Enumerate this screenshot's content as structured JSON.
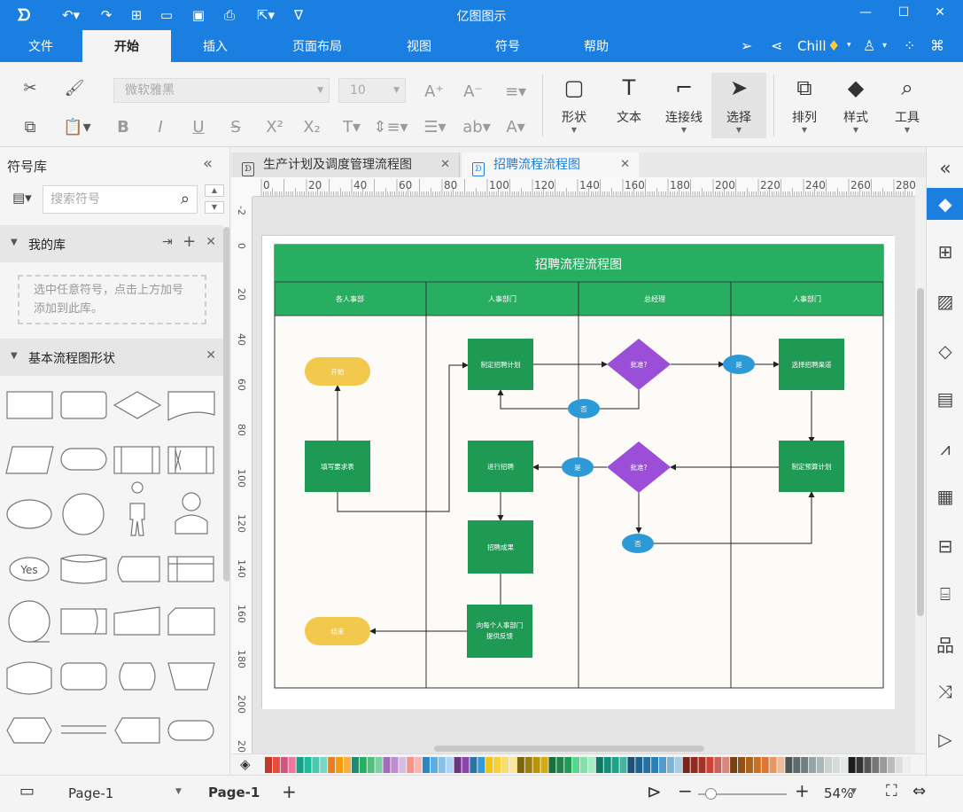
{
  "app": {
    "title": "亿图图示"
  },
  "menu": {
    "tabs": [
      "文件",
      "开始",
      "插入",
      "页面布局",
      "视图",
      "符号",
      "帮助"
    ],
    "active": "开始",
    "user": "Chill"
  },
  "ribbon": {
    "font_name": "微软雅黑",
    "font_size": "10",
    "big_buttons": [
      "形状",
      "文本",
      "连接线",
      "选择",
      "排列",
      "样式",
      "工具"
    ]
  },
  "left_panel": {
    "title": "符号库",
    "search_placeholder": "搜索符号",
    "my_library": "我的库",
    "my_library_hint": "选中任意符号，点击上方加号添加到此库。",
    "basic_shapes": "基本流程图形状",
    "yes_shape_label": "Yes"
  },
  "doc_tabs": [
    {
      "label": "生产计划及调度管理流程图",
      "active": false
    },
    {
      "label": "招聘流程流程图",
      "active": true
    }
  ],
  "rulers": {
    "top": [
      "0",
      "20",
      "40",
      "60",
      "80",
      "100",
      "120",
      "140",
      "160",
      "180",
      "200",
      "220",
      "240",
      "260",
      "280"
    ],
    "left": [
      "-2",
      "0",
      "20",
      "40",
      "60",
      "80",
      "100",
      "120",
      "140",
      "160",
      "180",
      "200",
      "20"
    ]
  },
  "diagram": {
    "title": "招聘流程流程图",
    "lanes": [
      "各人事部",
      "人事部门",
      "总经理",
      "人事部门"
    ],
    "nodes": {
      "start": "开始",
      "fill_form": "填写要求表",
      "end": "结束",
      "make_plan": "制定招聘计划",
      "approve1": "批准?",
      "yes1": "是",
      "no1": "否",
      "channel": "选择招聘渠道",
      "budget": "制定预算计划",
      "approve2": "批准?",
      "yes2": "是",
      "no2": "否",
      "recruit": "进行招聘",
      "result": "招聘成果",
      "feedback1": "向每个人事部门",
      "feedback2": "提供反馈"
    }
  },
  "colors": {
    "brand": "#1a7fe0",
    "header_green": "#27ae60",
    "process_green": "#1e9a54",
    "decision_purple": "#9b4fd9",
    "terminal_yellow": "#f2c94c",
    "connector_blue": "#2d9ad8"
  },
  "statusbar": {
    "page_selector": "Page-1",
    "page_tab": "Page-1",
    "zoom": "54%"
  }
}
